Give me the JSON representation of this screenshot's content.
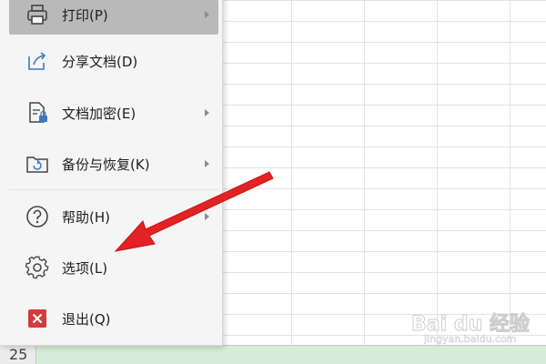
{
  "menu": {
    "items": [
      {
        "label": "打印(P)",
        "icon": "printer-icon",
        "has_submenu": true
      },
      {
        "label": "分享文档(D)",
        "icon": "share-icon",
        "has_submenu": false
      },
      {
        "label": "文档加密(E)",
        "icon": "encrypt-doc-icon",
        "has_submenu": true
      },
      {
        "label": "备份与恢复(K)",
        "icon": "backup-restore-icon",
        "has_submenu": true
      },
      {
        "label": "帮助(H)",
        "icon": "help-icon",
        "has_submenu": true
      },
      {
        "label": "选项(L)",
        "icon": "gear-icon",
        "has_submenu": false
      },
      {
        "label": "退出(Q)",
        "icon": "exit-icon",
        "has_submenu": false
      }
    ]
  },
  "sheet": {
    "visible_row_number": "25"
  },
  "annotation": {
    "arrow_color": "#e32323"
  },
  "watermark": {
    "brand": "Bai du 经验",
    "url": "jingyan.baidu.com"
  }
}
